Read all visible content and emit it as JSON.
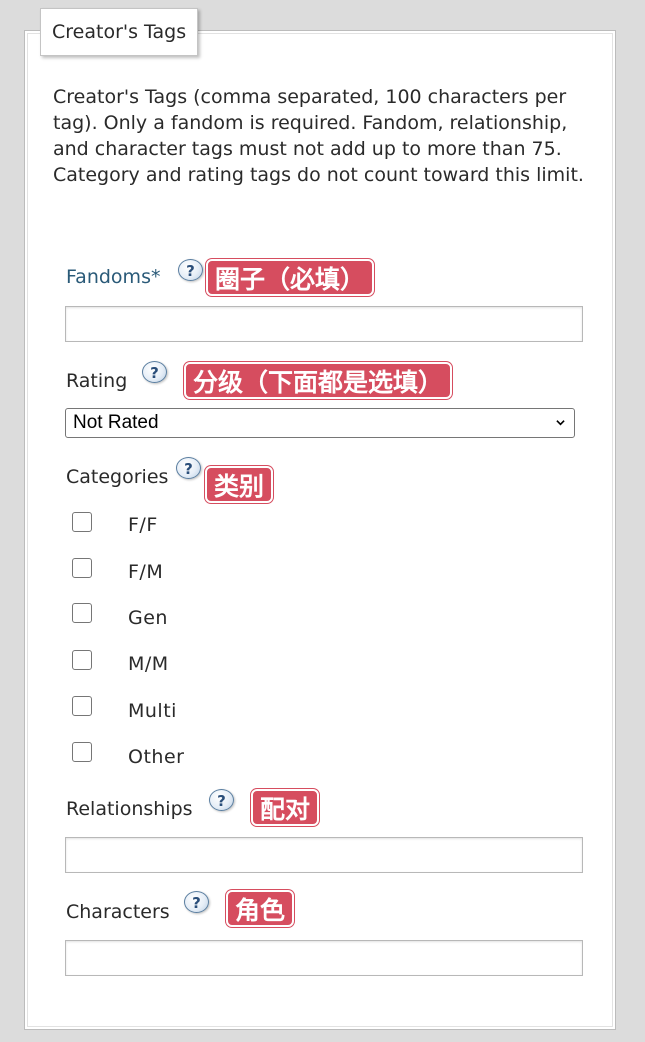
{
  "legend": "Creator's Tags",
  "description": "Creator's Tags (comma separated, 100 characters per tag). Only a fandom is required. Fandom, relationship, and character tags must not add up to more than 75. Category and rating tags do not count toward this limit.",
  "help_glyph": "?",
  "fandoms": {
    "label": "Fandoms*",
    "annotation": "圈子（必填）",
    "value": ""
  },
  "rating": {
    "label": "Rating",
    "annotation": "分级（下面都是选填）",
    "selected": "Not Rated"
  },
  "categories": {
    "label": "Categories",
    "annotation": "类别",
    "options": [
      {
        "label": "F/F",
        "checked": false
      },
      {
        "label": "F/M",
        "checked": false
      },
      {
        "label": "Gen",
        "checked": false
      },
      {
        "label": "M/M",
        "checked": false
      },
      {
        "label": "Multi",
        "checked": false
      },
      {
        "label": "Other",
        "checked": false
      }
    ]
  },
  "relationships": {
    "label": "Relationships",
    "annotation": "配对",
    "value": ""
  },
  "characters": {
    "label": "Characters",
    "annotation": "角色",
    "value": ""
  },
  "colors": {
    "annotation_bg": "#d64d5f",
    "required_label": "#2a5a78",
    "page_bg": "#dcdcdc"
  }
}
